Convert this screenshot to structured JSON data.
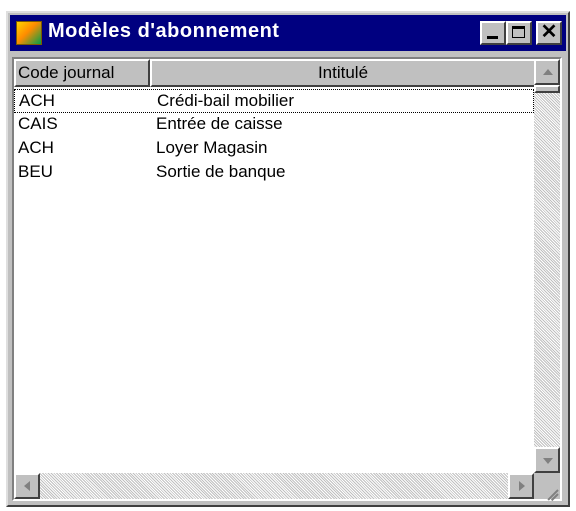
{
  "window": {
    "title": "Modèles d'abonnement",
    "icon": "app-icon",
    "controls": {
      "minimize_icon": "minimize-icon",
      "maximize_icon": "maximize-icon",
      "close_icon": "close-icon",
      "close_glyph": "✕"
    }
  },
  "columns": {
    "code": "Code journal",
    "intitule": "Intitulé"
  },
  "rows": [
    {
      "code": "ACH",
      "intitule": "Crédi-bail mobilier",
      "selected": true
    },
    {
      "code": "CAIS",
      "intitule": "Entrée de caisse",
      "selected": false
    },
    {
      "code": "ACH",
      "intitule": "Loyer Magasin",
      "selected": false
    },
    {
      "code": "BEU",
      "intitule": "Sortie de banque",
      "selected": false
    }
  ],
  "colors": {
    "titlebar": "#000080",
    "face": "#c0c0c0",
    "title_text": "#ffffff"
  }
}
